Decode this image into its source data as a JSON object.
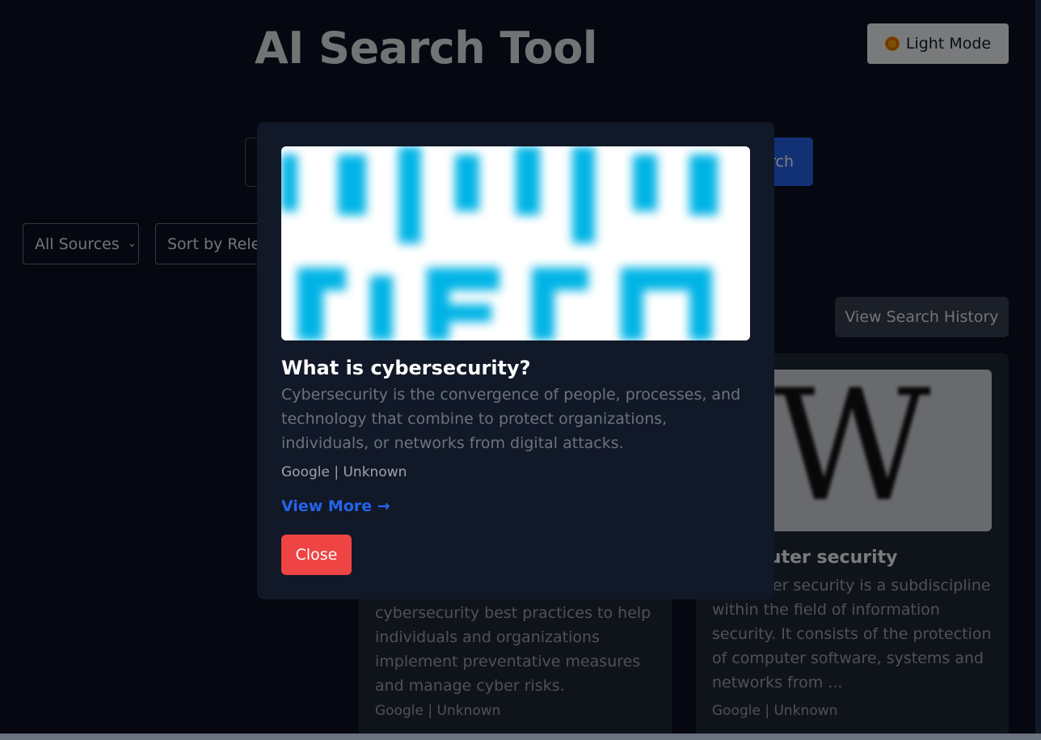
{
  "header": {
    "title": "AI Search Tool",
    "theme_toggle_label": "Light Mode",
    "theme_icon": "sun-icon"
  },
  "search": {
    "button_label": "Search"
  },
  "filters": {
    "source_selected": "All Sources",
    "sort_selected": "Sort by Relevance"
  },
  "history_button_label": "View Search History",
  "results": [
    {
      "title": "",
      "description": "cybersecurity best practices to help individuals and organizations implement preventative measures and manage cyber risks.",
      "meta": "Google | Unknown"
    },
    {
      "title": "Computer security",
      "description": "Computer security is a subdiscipline within the field of information security. It consists of the protection of computer software, systems and networks from ...",
      "meta": "Google | Unknown",
      "image_icon": "wikipedia-logo"
    }
  ],
  "modal": {
    "title": "What is cybersecurity?",
    "description": "Cybersecurity is the convergence of people, processes, and technology that combine to protect organizations, individuals, or networks from digital attacks.",
    "meta": "Google | Unknown",
    "link_label": "View More →",
    "close_label": "Close"
  },
  "colors": {
    "background": "#0b1120",
    "modal_bg": "#111827",
    "link": "#2563eb",
    "close": "#ef4444",
    "image_accent": "#00b4e6"
  }
}
